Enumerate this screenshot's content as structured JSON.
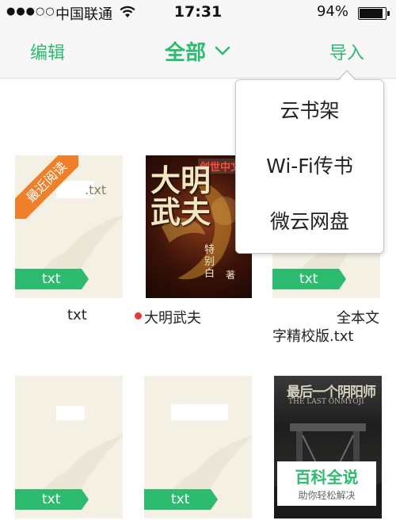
{
  "status_bar": {
    "signal": "●●●○○",
    "carrier": "中国联通",
    "time": "17:31",
    "battery_percent": "94%",
    "battery_level": 0.94
  },
  "nav": {
    "edit_label": "编辑",
    "title": "全部",
    "import_label": "导入",
    "accent_color": "#2dbb6f"
  },
  "import_menu": {
    "items": [
      "云书架",
      "Wi-Fi传书",
      "微云网盘"
    ]
  },
  "books": [
    {
      "cover_filename": ".txt",
      "tag": "txt",
      "ribbon": "最近阅读",
      "label": "txt"
    },
    {
      "cover_title": "大明武夫",
      "cover_publisher": "创世中文",
      "cover_author": "特别白",
      "cover_mark": "著",
      "label": "大明武夫",
      "unread_dot": true
    },
    {
      "tag": "txt",
      "label_line1": "全本文",
      "label_line2": "字精校版.txt"
    },
    {
      "tag": "txt"
    },
    {
      "tag": "txt"
    },
    {
      "cover_title": "最后一个阴阳师",
      "cover_subtitle": "THE LAST ONMYOJI"
    }
  ],
  "watermark": {
    "title": "百科全说",
    "subtitle": "助你轻松解决"
  }
}
